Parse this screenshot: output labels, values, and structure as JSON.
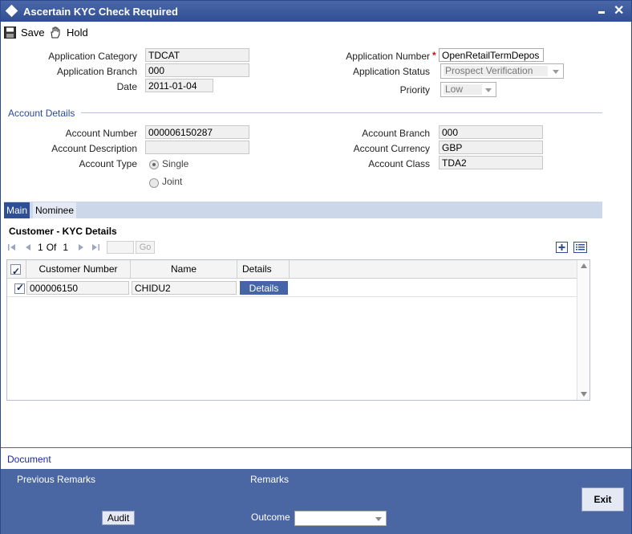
{
  "window": {
    "title": "Ascertain KYC Check Required"
  },
  "toolbar": {
    "save_label": "Save",
    "hold_label": "Hold"
  },
  "header": {
    "application_category_label": "Application Category",
    "application_category_value": "TDCAT",
    "application_branch_label": "Application Branch",
    "application_branch_value": "000",
    "date_label": "Date",
    "date_value": "2011-01-04",
    "application_number_label": "Application Number",
    "application_number_value": "OpenRetailTermDepos",
    "application_status_label": "Application Status",
    "application_status_value": "Prospect Verification",
    "priority_label": "Priority",
    "priority_value": "Low"
  },
  "account": {
    "section_title": "Account Details",
    "account_number_label": "Account Number",
    "account_number_value": "000006150287",
    "account_description_label": "Account Description",
    "account_description_value": "",
    "account_type_label": "Account Type",
    "account_type_single": "Single",
    "account_type_joint": "Joint",
    "account_branch_label": "Account Branch",
    "account_branch_value": "000",
    "account_currency_label": "Account Currency",
    "account_currency_value": "GBP",
    "account_class_label": "Account Class",
    "account_class_value": "TDA2"
  },
  "tabs": [
    {
      "label": "Main",
      "active": true
    },
    {
      "label": "Nominee",
      "active": false
    }
  ],
  "kyc_grid": {
    "title": "Customer - KYC Details",
    "pager": {
      "current": "1",
      "of_label": "Of",
      "total": "1",
      "go_label": "Go"
    },
    "columns": [
      "Customer Number",
      "Name",
      "Details"
    ],
    "rows": [
      {
        "customer_number": "000006150",
        "name": "CHIDU2",
        "details_label": "Details"
      }
    ]
  },
  "footer": {
    "document_link": "Document",
    "previous_remarks_label": "Previous Remarks",
    "remarks_label": "Remarks",
    "audit_label": "Audit",
    "outcome_label": "Outcome",
    "outcome_value": "",
    "exit_label": "Exit"
  },
  "colors": {
    "accent": "#2e4f95",
    "panel": "#4b67a3"
  }
}
